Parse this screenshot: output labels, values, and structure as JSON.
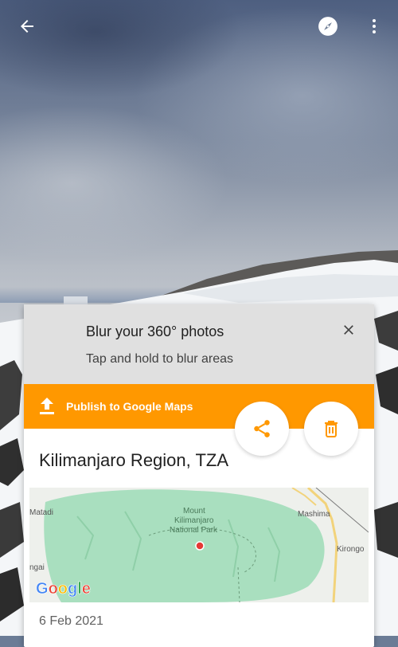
{
  "tip": {
    "title": "Blur your 360° photos",
    "subtitle": "Tap and hold to blur areas"
  },
  "publish": {
    "label": "Publish to Google Maps"
  },
  "place": {
    "name": "Kilimanjaro Region, TZA"
  },
  "map": {
    "labels": {
      "matadi": "Matadi",
      "mashima": "Mashima",
      "mount_line1": "Mount",
      "mount_line2": "Kilimanjaro",
      "mount_line3": "National Park",
      "kirongo": "Kirongo",
      "left_edge": "ngai"
    },
    "logo": "Google"
  },
  "photo": {
    "date": "6 Feb 2021"
  },
  "colors": {
    "accent": "#ff9800",
    "tip_bg": "#e0e0e0",
    "map_marker": "#e53935",
    "park_green": "#a9dfbf"
  },
  "icons": {
    "back": "arrow-left-icon",
    "compass": "compass-icon",
    "more": "more-vert-icon",
    "close": "close-icon",
    "upload": "upload-icon",
    "share": "share-icon",
    "delete": "trash-icon"
  }
}
